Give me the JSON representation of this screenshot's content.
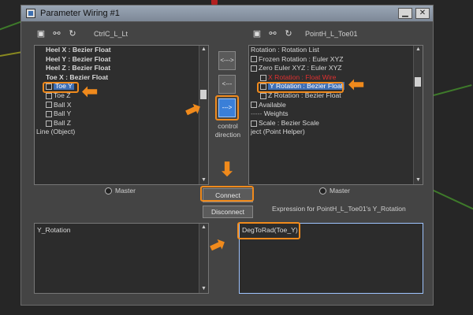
{
  "window": {
    "title": "Parameter Wiring #1"
  },
  "left_panel": {
    "name": "CtrlC_L_Lt",
    "items": [
      {
        "label": "Heel X : Bezier Float",
        "bold": true
      },
      {
        "label": "Heel Y : Bezier Float",
        "bold": true
      },
      {
        "label": "Heel Z : Bezier Float",
        "bold": true
      },
      {
        "label": "Toe X : Bezier Float",
        "bold": true
      },
      {
        "label": "Toe Y",
        "selected": true
      },
      {
        "label": "Toe Z"
      },
      {
        "label": "Ball X"
      },
      {
        "label": "Ball Y"
      },
      {
        "label": "Ball Z"
      },
      {
        "label": "Line (Object)"
      }
    ],
    "master_label": "Master",
    "expression_text": "Y_Rotation"
  },
  "right_panel": {
    "name": "PointH_L_Toe01",
    "items": [
      {
        "label": "Rotation : Rotation List"
      },
      {
        "label": "Frozen Rotation : Euler XYZ"
      },
      {
        "label": "Zero Euler XYZ : Euler XYZ"
      },
      {
        "label": "X Rotation : Float Wire",
        "red": true
      },
      {
        "label": "Y Rotation : Bezier Float",
        "selected": true
      },
      {
        "label": "Z Rotation : Bezier Float"
      },
      {
        "label": "Available"
      },
      {
        "label": "Weights"
      },
      {
        "label": "Scale : Bezier Scale"
      },
      {
        "label": "ject (Point Helper)"
      }
    ],
    "master_label": "Master",
    "expression_label": "Expression for PointH_L_Toe01's Y_Rotation",
    "expression_text": "DegToRad(Toe_Y)"
  },
  "center": {
    "both_dir_label": "<--->",
    "left_dir_label": "<---",
    "right_dir_label": "--->",
    "control_direction_label": "control direction",
    "connect_label": "Connect",
    "disconnect_label": "Disconnect"
  },
  "colors": {
    "annotation": "#f08a1c",
    "selection": "#3f6fb5",
    "active_button": "#3a7fd8",
    "wire_red": "#e03030"
  }
}
